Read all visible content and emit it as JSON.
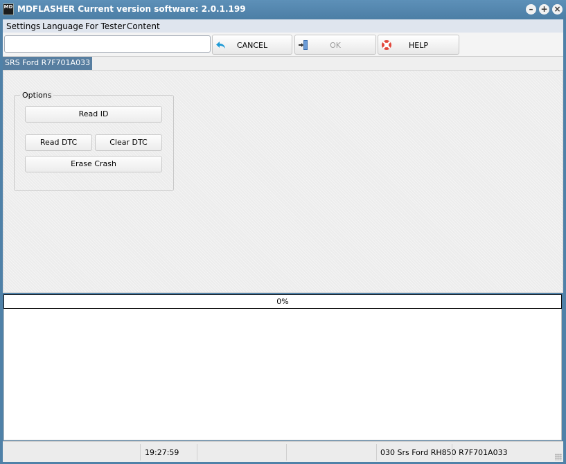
{
  "window": {
    "app_name": "MDFLASHER",
    "title_suffix": "Current version software: 2.0.1.199",
    "icon_text": "MD",
    "controls": [
      "minimize-icon",
      "maximize-icon",
      "close-icon"
    ]
  },
  "menu": {
    "items": [
      "Settings",
      "Language",
      "For Tester",
      "Content"
    ]
  },
  "toolbar": {
    "input_value": "",
    "cancel_label": "CANCEL",
    "ok_label": "OK",
    "help_label": "HELP",
    "icons": {
      "cancel": "back-arrow-icon",
      "ok": "exit-door-icon",
      "help": "lifebuoy-icon"
    }
  },
  "tabs": [
    {
      "label": "SRS Ford R7F701A033",
      "active": true
    }
  ],
  "options": {
    "group_title": "Options",
    "read_id": "Read ID",
    "read_dtc": "Read DTC",
    "clear_dtc": "Clear DTC",
    "erase_crash": "Erase Crash"
  },
  "progress": {
    "value": 0,
    "label": "0%"
  },
  "log": {
    "lines": []
  },
  "status": {
    "time": "19:27:59",
    "module": "030 Srs Ford RH850 R7F701A033"
  },
  "colors": {
    "titlebar": "#4f81a8",
    "menubar": "#dfe5ee",
    "tab_active": "#577ea0"
  }
}
